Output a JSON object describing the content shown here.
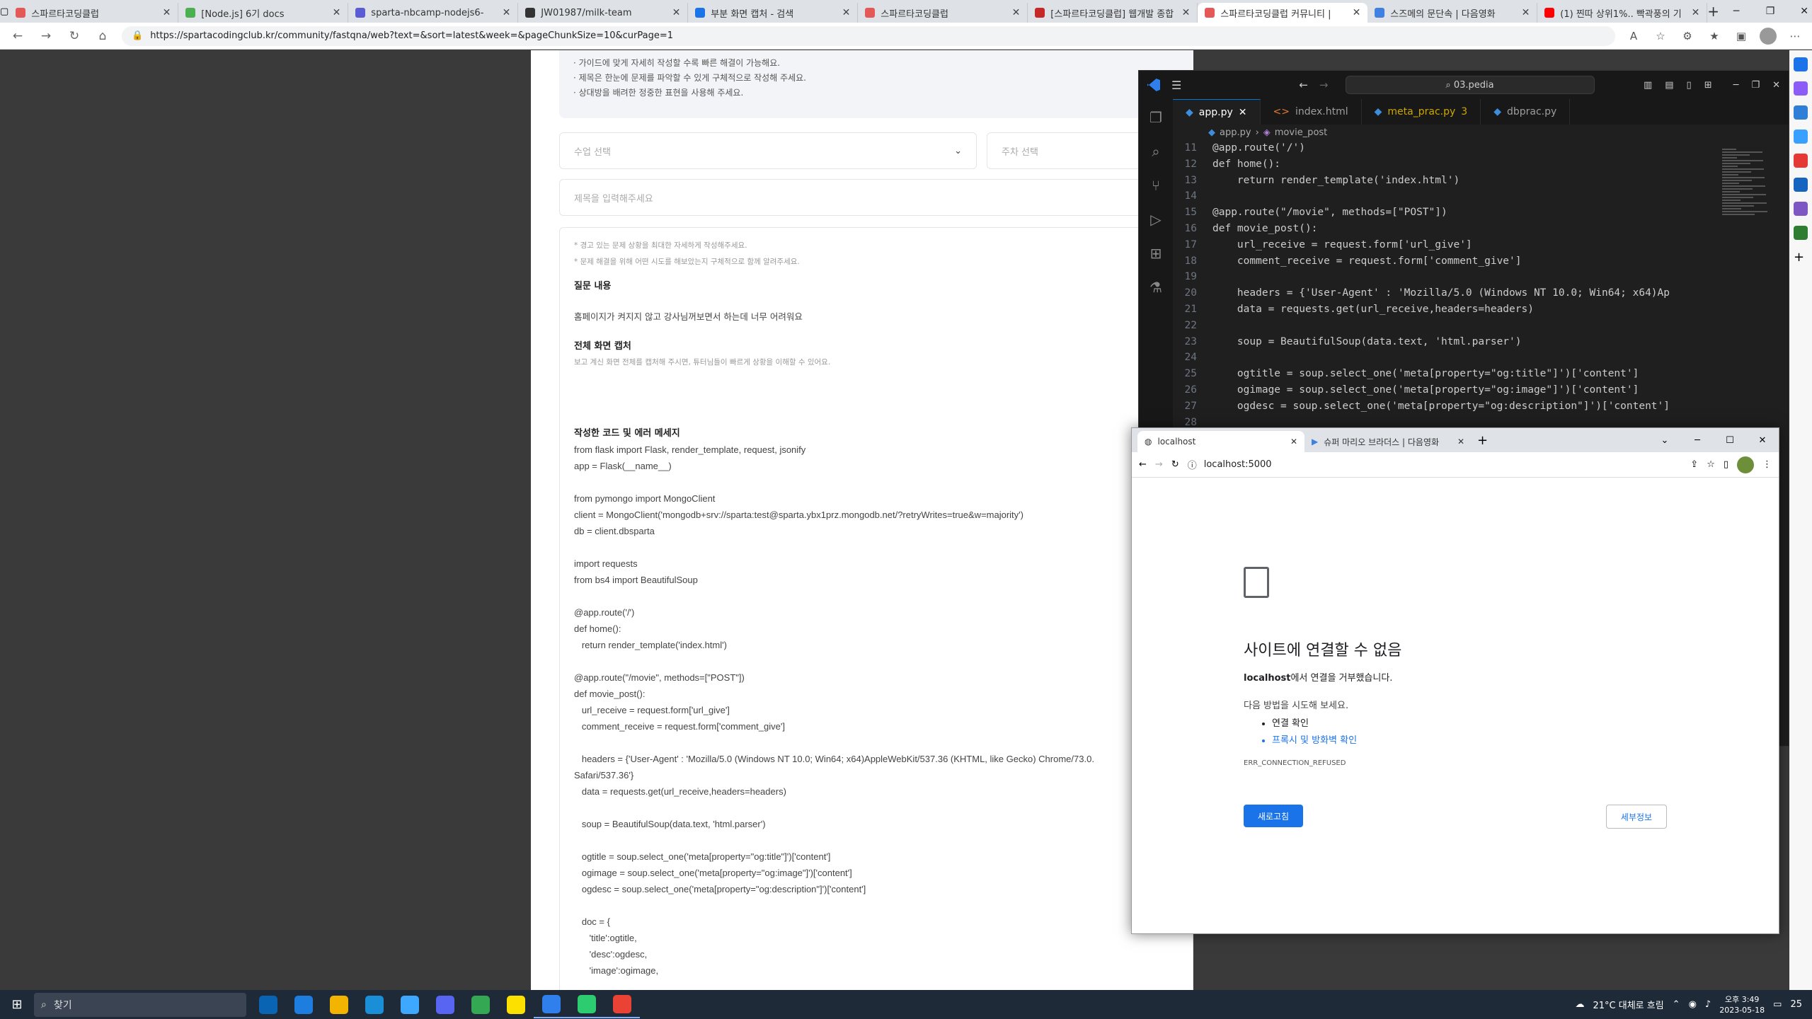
{
  "browser": {
    "tabs": [
      {
        "label": "스파르타코딩클럽",
        "color": "#e45858"
      },
      {
        "label": "[Node.js] 6기 docs",
        "color": "#4caf50"
      },
      {
        "label": "sparta-nbcamp-nodejs6-",
        "color": "#5b5bd6"
      },
      {
        "label": "JW01987/milk-team",
        "color": "#333333"
      },
      {
        "label": "부분 화면 캡처 - 검색",
        "color": "#1a73e8"
      },
      {
        "label": "스파르타코딩클럽",
        "color": "#e45858"
      },
      {
        "label": "[스파르타코딩클럽] 웹개발 종합",
        "color": "#c62828"
      },
      {
        "label": "스파르타코딩클럽 커뮤니티 |",
        "color": "#e45858",
        "active": true
      },
      {
        "label": "스즈메의 문단속 | 다음영화",
        "color": "#3f80e0"
      },
      {
        "label": "(1) 찐따 상위1%.. 빡곽풍의 기",
        "color": "#ff0000"
      }
    ],
    "new_tab": "+",
    "url": "https://spartacodingclub.kr/community/fastqna/web?text=&sort=latest&week=&pageChunkSize=10&curPage=1"
  },
  "page": {
    "guide": [
      "· 가이드에 맞게 자세히 작성할 수록 빠른 해결이 가능해요.",
      "· 제목은 한눈에 문제를 파악할 수 있게 구체적으로 작성해 주세요.",
      "· 상대방을 배려한 정중한 표현을 사용해 주세요."
    ],
    "class_select": "수업 선택",
    "week_select": "주차 선택",
    "title_placeholder": "제목을 입력해주세요",
    "hint1": "* 경고 있는 문제 상황을 최대한 자세하게 작성해주세요.",
    "hint2": "* 문제 해결을 위해 어떤 시도를 해보았는지 구체적으로 함께 알려주세요.",
    "q_heading": "질문 내용",
    "q_text": "홈페이지가 켜지지 않고 강사님꺼보면서 하는데 너무 어려워요",
    "cap_heading": "전체 화면 캡처",
    "cap_hint": "보고 계신 화면 전체를 캡처해 주시면, 튜터님들이 빠르게 상황을 이해할 수 있어요.",
    "code_heading": "작성한 코드 및 에러 메세지",
    "code_lines": [
      "from flask import Flask, render_template, request, jsonify",
      "app = Flask(__name__)",
      "",
      "from pymongo import MongoClient",
      "client = MongoClient('mongodb+srv://sparta:test@sparta.ybx1prz.mongodb.net/?retryWrites=true&w=majority')",
      "db = client.dbsparta",
      "",
      "import requests",
      "from bs4 import BeautifulSoup",
      "",
      "@app.route('/')",
      "def home():",
      "   return render_template('index.html')",
      "",
      "@app.route(\"/movie\", methods=[\"POST\"])",
      "def movie_post():",
      "   url_receive = request.form['url_give']",
      "   comment_receive = request.form['comment_give']",
      "",
      "   headers = {'User-Agent' : 'Mozilla/5.0 (Windows NT 10.0; Win64; x64)AppleWebKit/537.36 (KHTML, like Gecko) Chrome/73.0.",
      "Safari/537.36'}",
      "   data = requests.get(url_receive,headers=headers)",
      "",
      "   soup = BeautifulSoup(data.text, 'html.parser')",
      "",
      "   ogtitle = soup.select_one('meta[property=\"og:title\"]')['content']",
      "   ogimage = soup.select_one('meta[property=\"og:image\"]')['content']",
      "   ogdesc = soup.select_one('meta[property=\"og:description\"]')['content']",
      "",
      "   doc = {",
      "      'title':ogtitle,",
      "      'desc':ogdesc,",
      "      'image':ogimage,"
    ]
  },
  "vscode": {
    "search": "03.pedia",
    "tabs": [
      {
        "label": "app.py",
        "active": true
      },
      {
        "label": "index.html"
      },
      {
        "label": "meta_prac.py",
        "badge": "3"
      },
      {
        "label": "dbprac.py"
      }
    ],
    "crumb_file": "app.py",
    "crumb_symbol": "movie_post",
    "lines": [
      {
        "n": "11",
        "t": "@app.route('/')"
      },
      {
        "n": "12",
        "t": "def home():"
      },
      {
        "n": "13",
        "t": "    return render_template('index.html')"
      },
      {
        "n": "14",
        "t": ""
      },
      {
        "n": "15",
        "t": "@app.route(\"/movie\", methods=[\"POST\"])"
      },
      {
        "n": "16",
        "t": "def movie_post():"
      },
      {
        "n": "17",
        "t": "    url_receive = request.form['url_give']"
      },
      {
        "n": "18",
        "t": "    comment_receive = request.form['comment_give']"
      },
      {
        "n": "19",
        "t": ""
      },
      {
        "n": "20",
        "t": "    headers = {'User-Agent' : 'Mozilla/5.0 (Windows NT 10.0; Win64; x64)Ap"
      },
      {
        "n": "21",
        "t": "    data = requests.get(url_receive,headers=headers)"
      },
      {
        "n": "22",
        "t": ""
      },
      {
        "n": "23",
        "t": "    soup = BeautifulSoup(data.text, 'html.parser')"
      },
      {
        "n": "24",
        "t": ""
      },
      {
        "n": "25",
        "t": "    ogtitle = soup.select_one('meta[property=\"og:title\"]')['content']"
      },
      {
        "n": "26",
        "t": "    ogimage = soup.select_one('meta[property=\"og:image\"]')['content']"
      },
      {
        "n": "27",
        "t": "    ogdesc = soup.select_one('meta[property=\"og:description\"]')['content']"
      },
      {
        "n": "28",
        "t": ""
      }
    ]
  },
  "chrome": {
    "tabs": [
      {
        "label": "localhost",
        "active": true
      },
      {
        "label": "슈퍼 마리오 브라더스 | 다음영화"
      }
    ],
    "url": "localhost:5000",
    "error_title": "사이트에 연결할 수 없음",
    "error_host": "localhost",
    "error_desc": "에서 연결을 거부했습니다.",
    "try_text": "다음 방법을 시도해 보세요.",
    "suggestions": [
      "연결 확인",
      "프록시 및 방화벽 확인"
    ],
    "error_code": "ERR_CONNECTION_REFUSED",
    "reload_label": "새로고침",
    "details_label": "세부정보"
  },
  "taskbar": {
    "search_label": "찾기",
    "weather": "21°C 대체로 흐림",
    "time": "오후 3:49",
    "date": "2023-05-18",
    "notif": "25",
    "apps": [
      "#0a64b4",
      "#1e7ee0",
      "#f3b400",
      "#1a8fd8",
      "#3ea8ff",
      "#5865f2",
      "#34a853",
      "#fce000",
      "#2f80ed",
      "#2ecc71",
      "#ea4335"
    ]
  }
}
